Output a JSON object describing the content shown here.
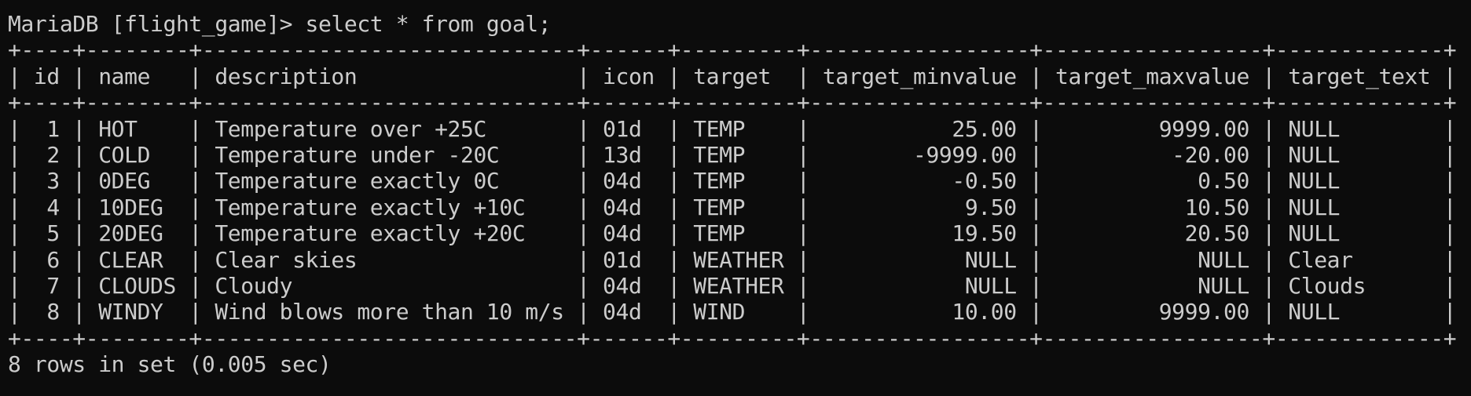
{
  "terminal": {
    "prompt": "MariaDB [flight_game]> select * from goal;",
    "border": "+----+--------+-----------------------------+------+---------+-----------------+-----------------+-------------+",
    "header": "| id | name   | description                 | icon | target  | target_minvalue | target_maxvalue | target_text |",
    "rows": [
      "|  1 | HOT    | Temperature over +25C       | 01d  | TEMP    |           25.00 |         9999.00 | NULL        |",
      "|  2 | COLD   | Temperature under -20C      | 13d  | TEMP    |        -9999.00 |          -20.00 | NULL        |",
      "|  3 | 0DEG   | Temperature exactly 0C      | 04d  | TEMP    |           -0.50 |            0.50 | NULL        |",
      "|  4 | 10DEG  | Temperature exactly +10C    | 04d  | TEMP    |            9.50 |           10.50 | NULL        |",
      "|  5 | 20DEG  | Temperature exactly +20C    | 04d  | TEMP    |           19.50 |           20.50 | NULL        |",
      "|  6 | CLEAR  | Clear skies                 | 01d  | WEATHER |            NULL |            NULL | Clear       |",
      "|  7 | CLOUDS | Cloudy                      | 04d  | WEATHER |            NULL |            NULL | Clouds      |",
      "|  8 | WINDY  | Wind blows more than 10 m/s | 04d  | WIND    |           10.00 |         9999.00 | NULL        |"
    ],
    "footer": "8 rows in set (0.005 sec)"
  },
  "colors": {
    "background": "#0c0c0c",
    "text": "#cccccc"
  }
}
